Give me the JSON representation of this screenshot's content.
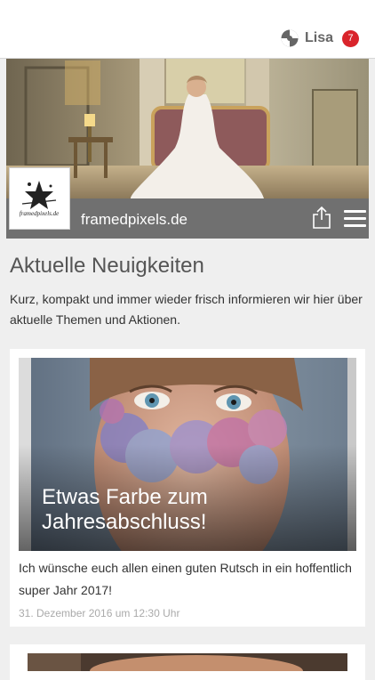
{
  "header": {
    "user_name": "Lisa",
    "notification_count": "7"
  },
  "site": {
    "name": "framedpixels.de",
    "logo_text": "framedpixels.de"
  },
  "main": {
    "title": "Aktuelle Neuigkeiten",
    "intro": "Kurz, kompakt und immer wieder frisch informieren wir hier über aktuelle Themen und Aktionen."
  },
  "posts": [
    {
      "title": "Etwas Farbe zum Jahresabschluss!",
      "excerpt": "Ich wünsche euch allen einen guten Rutsch in ein hoffentlich super Jahr 2017!",
      "date": "31. Dezember 2016 um 12:30 Uhr"
    }
  ],
  "icons": {
    "app_logo": "app-logo-icon",
    "share": "share-icon",
    "menu": "hamburger-menu-icon"
  },
  "colors": {
    "badge": "#d9242b",
    "site_bar": "#707070",
    "background": "#efefef"
  }
}
